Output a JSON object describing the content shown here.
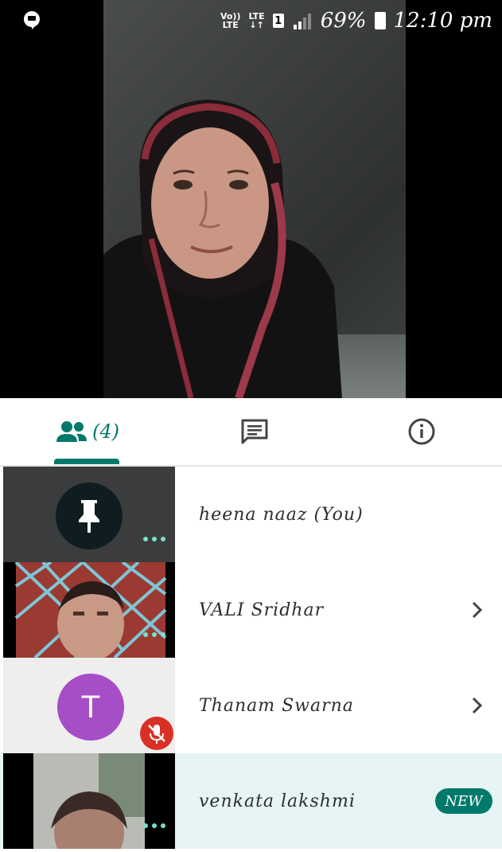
{
  "status_bar": {
    "volte": "Vo))\nLTE",
    "lte": "LTE",
    "sim": "1",
    "battery": "69%",
    "time": "12:10 pm"
  },
  "tabs": {
    "people_count": "(4)",
    "chat_icon": "chat-icon",
    "info_icon": "info-icon"
  },
  "participants": [
    {
      "name": "heena naaz (You)",
      "avatar": "pin-icon",
      "has_chevron": false
    },
    {
      "name": "VALI Sridhar",
      "avatar": "video-thumbnail",
      "has_chevron": true
    },
    {
      "name": "Thanam Swarna",
      "avatar_letter": "T",
      "muted": true,
      "has_chevron": true
    },
    {
      "name": "venkata lakshmi",
      "avatar": "video-thumbnail",
      "badge": "NEW"
    }
  ],
  "colors": {
    "accent": "#00796b",
    "avatar_purple": "#a64ec6",
    "mic_off_red": "#d93025",
    "highlight_row": "#e6f5f3"
  }
}
